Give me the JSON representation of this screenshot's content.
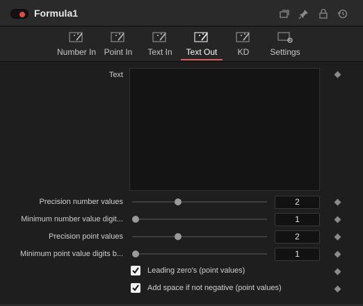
{
  "header": {
    "title": "Formula1",
    "icons": [
      "window-icon",
      "pin-icon",
      "lock-icon",
      "reset-icon"
    ]
  },
  "tabs": [
    {
      "label": "Number In",
      "icon": "wand-icon",
      "active": false
    },
    {
      "label": "Point In",
      "icon": "wand-icon",
      "active": false
    },
    {
      "label": "Text In",
      "icon": "wand-icon",
      "active": false
    },
    {
      "label": "Text Out",
      "icon": "wand-icon",
      "active": true
    },
    {
      "label": "KD",
      "icon": "wand-icon",
      "active": false
    },
    {
      "label": "Settings",
      "icon": "settings-icon",
      "active": false
    }
  ],
  "text_field": {
    "label": "Text",
    "value": ""
  },
  "sliders": [
    {
      "label": "Precision number values",
      "value": "2",
      "fraction": 0.33
    },
    {
      "label": "Minimum number value digit...",
      "value": "1",
      "fraction": 0.0
    },
    {
      "label": "Precision point values",
      "value": "2",
      "fraction": 0.33
    },
    {
      "label": "Minimum point value digits b...",
      "value": "1",
      "fraction": 0.0
    }
  ],
  "checkboxes": [
    {
      "label": "Leading zero's (point values)",
      "checked": true
    },
    {
      "label": "Add space if not negative (point values)",
      "checked": true
    }
  ],
  "colors": {
    "accent": "#e35a5a",
    "toggle_dot": "#e24a4a",
    "background": "#1e1e1e"
  }
}
